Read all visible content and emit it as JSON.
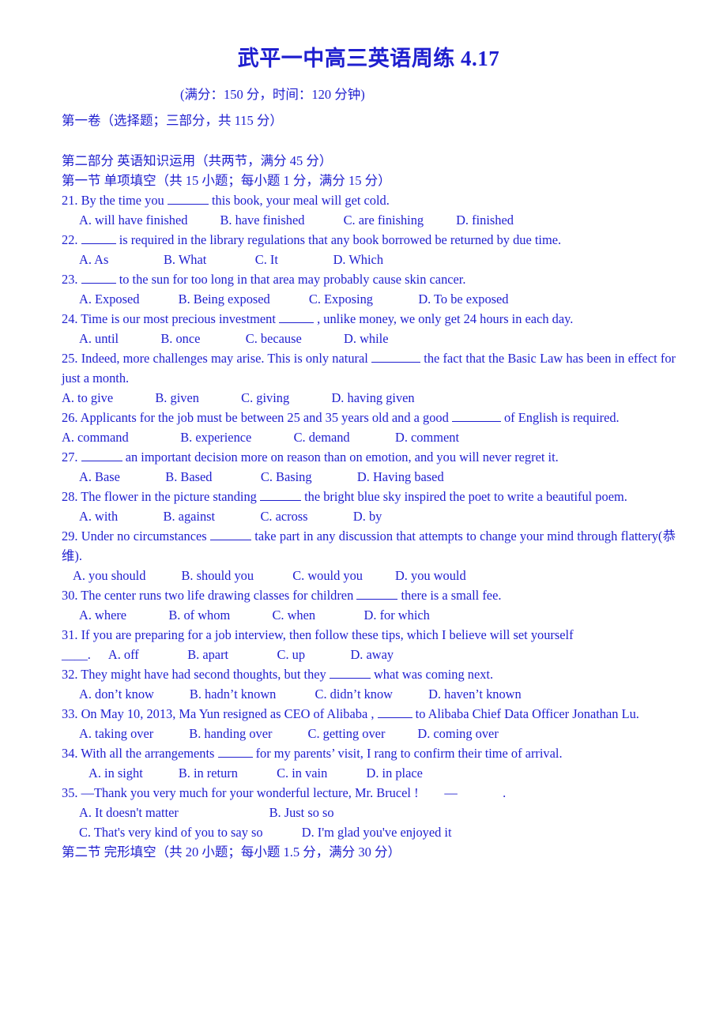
{
  "header": {
    "title": "武平一中高三英语周练 4.17",
    "subtitle": "(满分：150 分，时间：120 分钟)",
    "volume_line": "第一卷（选择题；三部分，共 115 分）",
    "part_line": "第二部分 英语知识运用（共两节，满分 45 分）",
    "section_line": "第一节 单项填空（共 15 小题；每小题 1 分，满分 15 分）"
  },
  "questions": [
    {
      "number": "21.",
      "stem_pre": "21. By the time you ",
      "stem_post": " this book, your meal will get cold.",
      "options_line": "A. will have finished          B. have finished            C. are finishing          D. finished"
    },
    {
      "number": "22.",
      "stem_pre": "22. ",
      "stem_post": " is required in the library regulations that any book borrowed be returned by due time.",
      "options_line": "A. As                 B. What               C. It                 D. Which"
    },
    {
      "number": "23.",
      "stem_pre": "23. ",
      "stem_post": " to the sun for too long in that area may probably cause skin cancer.",
      "options_line": "A. Exposed            B. Being exposed            C. Exposing              D. To be exposed"
    },
    {
      "number": "24.",
      "stem_pre": "24. Time is our most precious investment ",
      "stem_post": " , unlike money, we only get 24 hours in each day.",
      "options_line": "A. until             B. once              C. because             D. while"
    },
    {
      "number": "25.",
      "stem_pre": "  25. Indeed, more challenges may arise. This is only natural ",
      "stem_post": " the fact that the Basic Law has been in effect for just a month.",
      "options_line": "A. to give             B. given             C. giving             D. having given"
    },
    {
      "number": "26.",
      "stem_pre": "26. Applicants for the job must be between 25 and 35 years old and a good ",
      "stem_post": " of English is required.",
      "options_line": "A. command                B. experience             C. demand              D. comment"
    },
    {
      "number": "27.",
      "stem_pre": "27. ",
      "stem_post": " an important decision more on reason than on emotion, and you will never regret it.",
      "options_line": "A. Base              B. Based               C. Basing              D. Having based"
    },
    {
      "number": "28.",
      "stem_pre": "28. The flower in the picture standing ",
      "stem_post": " the bright blue sky inspired the poet to write a beautiful poem.",
      "options_line": "A. with              B. against              C. across              D. by"
    },
    {
      "number": "29.",
      "stem_pre": "29. Under no circumstances ",
      "stem_post": " take part in any discussion that attempts to change your mind through flattery(恭维).",
      "options_line": "A. you should           B. should you            C. would you          D. you would"
    },
    {
      "number": "30.",
      "stem_pre": "30. The center runs two life drawing classes for children ",
      "stem_post": " there is a small fee.",
      "options_line": "A. where             B. of whom             C. when               D. for which"
    },
    {
      "number": "31.",
      "stem_pre": "31. If you are preparing for a job interview, then follow these tips, which I believe will set yourself",
      "stem_post": "____.",
      "options_line": "A. off               B. apart               C. up              D. away"
    },
    {
      "number": "32.",
      "stem_pre": "32. They might have had second thoughts, but they ",
      "stem_post": " what was coming next.",
      "options_line": "A. don’t know           B. hadn’t known            C. didn’t know           D. haven’t known"
    },
    {
      "number": "33.",
      "stem_pre": "33. On May 10, 2013, Ma Yun resigned as CEO of Alibaba , ",
      "stem_post": " to Alibaba Chief Data Officer Jonathan Lu.",
      "options_line": "A. taking over           B. handing over           C. getting over          D. coming over"
    },
    {
      "number": "34.",
      "stem_pre": "34. With all the arrangements ",
      "stem_post": " for my parents’ visit, I rang to confirm their time of arrival.",
      "options_line": "A. in sight           B. in return            C. in vain            D. in place"
    },
    {
      "number": "35.",
      "stem_pre": "35. —Thank you very much for your wonderful lecture, Mr. Brucel !",
      "stem_post": "        —              .",
      "options_line_1": "A. It doesn't matter                            B. Just so so",
      "options_line_2": "C. That's very kind of you to say so            D. I'm glad you've enjoyed it"
    }
  ],
  "footer": {
    "section_two": "第二节 完形填空（共 20 小题；每小题 1.5 分，满分 30 分）"
  },
  "colors": {
    "text_blue": "#1f1fcf",
    "background": "#ffffff"
  }
}
